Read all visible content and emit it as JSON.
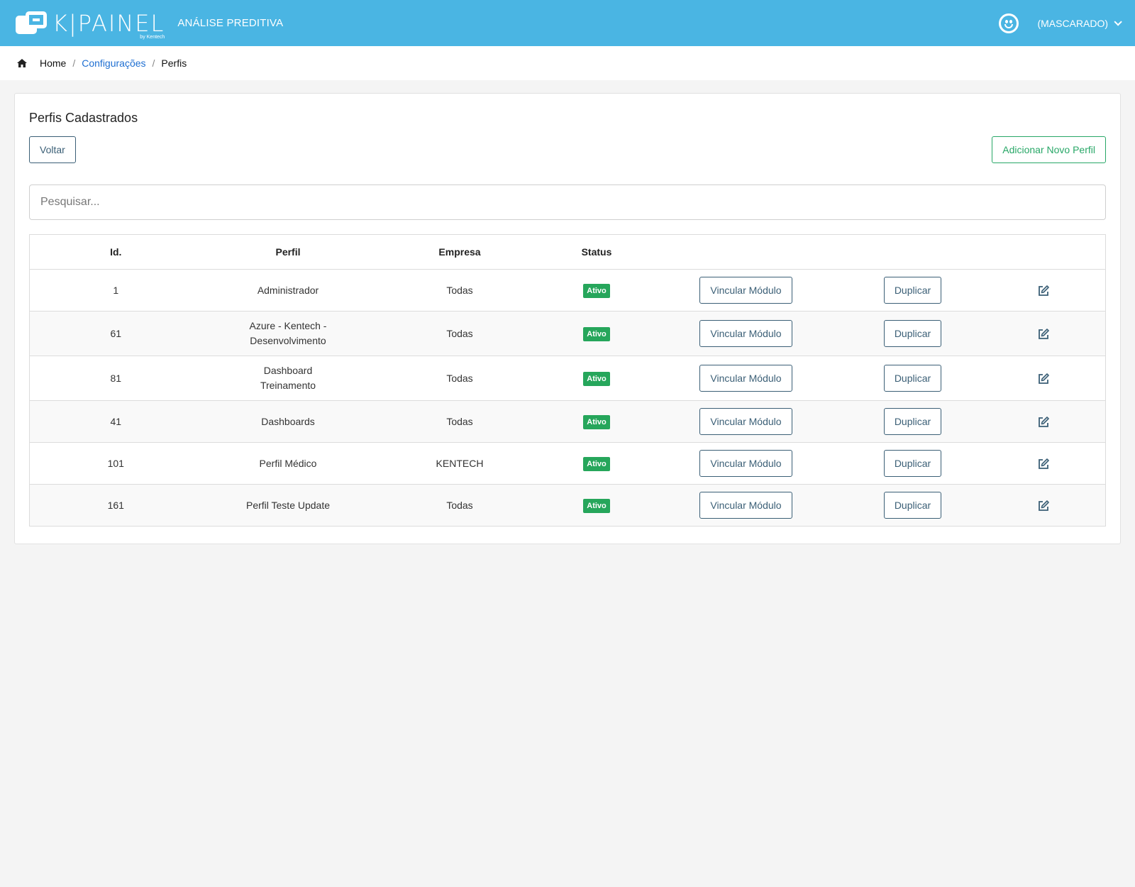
{
  "header": {
    "logo_text": "K|PAINEL",
    "logo_sub": "by Kentech",
    "app_name": "ANÁLISE PREDITIVA",
    "user_label": "(MASCARADO)"
  },
  "breadcrumb": {
    "home": "Home",
    "separator": "/",
    "config": "Configurações",
    "current": "Perfis"
  },
  "card": {
    "title": "Perfis Cadastrados",
    "back_label": "Voltar",
    "add_label": "Adicionar Novo Perfil",
    "search_placeholder": "Pesquisar..."
  },
  "table": {
    "headers": [
      "Id.",
      "Perfil",
      "Empresa",
      "Status"
    ],
    "link_module_label": "Vincular Módulo",
    "duplicate_label": "Duplicar",
    "rows": [
      {
        "id": "1",
        "perfil": "Administrador",
        "empresa": "Todas",
        "status": "Ativo"
      },
      {
        "id": "61",
        "perfil": "Azure - Kentech - Desenvolvimento",
        "empresa": "Todas",
        "status": "Ativo"
      },
      {
        "id": "81",
        "perfil": "Dashboard Treinamento",
        "empresa": "Todas",
        "status": "Ativo"
      },
      {
        "id": "41",
        "perfil": "Dashboards",
        "empresa": "Todas",
        "status": "Ativo"
      },
      {
        "id": "101",
        "perfil": "Perfil Médico",
        "empresa": "KENTECH",
        "status": "Ativo"
      },
      {
        "id": "161",
        "perfil": "Perfil Teste Update",
        "empresa": "Todas",
        "status": "Ativo"
      }
    ]
  },
  "colors": {
    "header_bg": "#4ab5e3",
    "status_green": "#26a65b",
    "link_blue": "#1e6fd2",
    "button_border": "#3b5f76"
  }
}
